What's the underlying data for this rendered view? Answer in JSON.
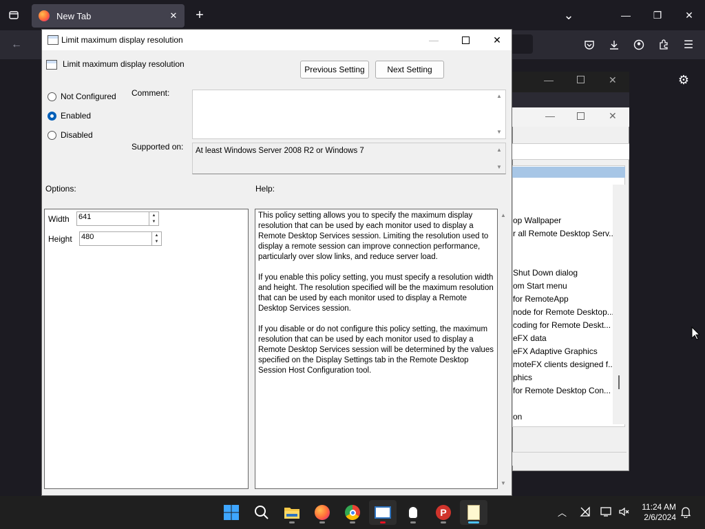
{
  "browser": {
    "tab_title": "New Tab",
    "tab_close": "✕",
    "new_tab": "+",
    "list_all_tabs": "⌄",
    "minimize": "—",
    "restore": "❐",
    "close": "✕"
  },
  "background_window": {
    "items": [
      "op Wallpaper",
      "r all Remote Desktop Serv...",
      "Shut Down dialog",
      "om Start menu",
      "for RemoteApp",
      "node for Remote Desktop...",
      "coding for Remote Deskt...",
      "eFX data",
      "eFX Adaptive Graphics",
      "moteFX clients designed f...",
      "phics",
      "for Remote Desktop Con...",
      "on"
    ]
  },
  "dialog": {
    "window_title": "Limit maximum display resolution",
    "setting_title": "Limit maximum display resolution",
    "previous_button": "Previous Setting",
    "next_button": "Next Setting",
    "radio_not_configured": "Not Configured",
    "radio_enabled": "Enabled",
    "radio_disabled": "Disabled",
    "selected_state": "Enabled",
    "comment_label": "Comment:",
    "comment_value": "",
    "supported_label": "Supported on:",
    "supported_value": "At least Windows Server 2008 R2 or Windows 7",
    "options_label": "Options:",
    "help_label": "Help:",
    "width_label": "Width",
    "width_value": "641",
    "height_label": "Height",
    "height_value": "480",
    "help_paragraphs": [
      "This policy setting allows you to specify the maximum display resolution that can be used by each monitor used to display a Remote Desktop Services session. Limiting the resolution used to display a remote session can improve connection performance, particularly over slow links, and reduce server load.",
      "If you enable this policy setting, you must specify a resolution width and height. The resolution specified will be the maximum resolution that can be used by each monitor used to display a Remote Desktop Services session.",
      "If you disable or do not configure this policy setting, the maximum resolution that can be used by each monitor used to display a Remote Desktop Services session will be determined by the values specified on the Display Settings tab in the Remote Desktop Session Host Configuration tool."
    ]
  },
  "taskbar": {
    "apps": [
      "start",
      "search",
      "file-explorer",
      "firefox",
      "chrome",
      "remote-desktop",
      "app-penguin",
      "app-p",
      "notepad"
    ],
    "time": "11:24 AM",
    "date": "2/6/2024"
  },
  "colors": {
    "accent": "#005fb8",
    "taskbar_bg": "#1f1f1f",
    "browser_dark": "#1c1b22"
  }
}
